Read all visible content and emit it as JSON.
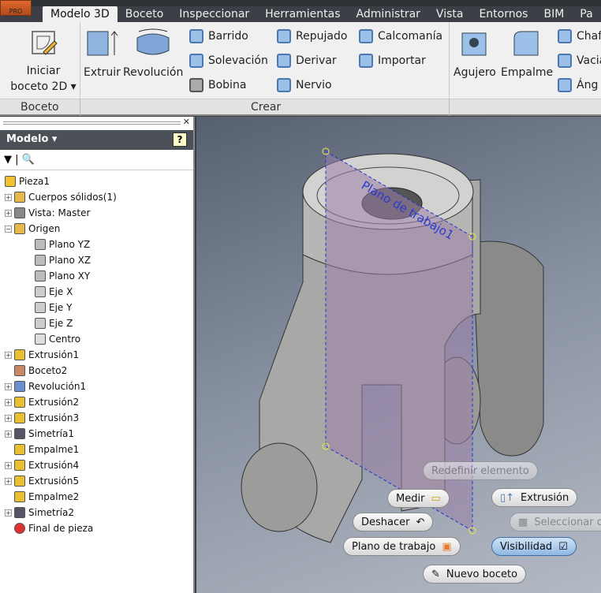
{
  "app": {
    "badge": "PRO"
  },
  "tabs": [
    "Modelo 3D",
    "Boceto",
    "Inspeccionar",
    "Herramientas",
    "Administrar",
    "Vista",
    "Entornos",
    "BIM",
    "Pa"
  ],
  "ribbon": {
    "boceto_panel": {
      "label": "Boceto",
      "start_sketch": "Iniciar",
      "start_sketch2": "boceto 2D"
    },
    "crear_panel": {
      "label": "Crear",
      "extrude": "Extruir",
      "revolve": "Revolución",
      "sweep": "Barrido",
      "loft": "Solevación",
      "coil": "Bobina",
      "emboss": "Repujado",
      "derive": "Derivar",
      "rib": "Nervio",
      "decal": "Calcomanía",
      "import": "Importar"
    },
    "modify": {
      "hole": "Agujero",
      "fillet": "Empalme",
      "chamfer": "Chaf",
      "shell": "Vacia",
      "draft": "Áng"
    }
  },
  "browser": {
    "title": "Modelo",
    "items": [
      {
        "label": "Pieza1",
        "level": 0,
        "icon": "part"
      },
      {
        "label": "Cuerpos sólidos(1)",
        "level": 1,
        "icon": "folder",
        "exp": true
      },
      {
        "label": "Vista: Master",
        "level": 1,
        "icon": "view",
        "exp": true
      },
      {
        "label": "Origen",
        "level": 1,
        "icon": "folder-open",
        "exp": true,
        "open": true
      },
      {
        "label": "Plano YZ",
        "level": 2,
        "icon": "plane"
      },
      {
        "label": "Plano XZ",
        "level": 2,
        "icon": "plane"
      },
      {
        "label": "Plano XY",
        "level": 2,
        "icon": "plane"
      },
      {
        "label": "Eje X",
        "level": 2,
        "icon": "axis"
      },
      {
        "label": "Eje Y",
        "level": 2,
        "icon": "axis"
      },
      {
        "label": "Eje Z",
        "level": 2,
        "icon": "axis"
      },
      {
        "label": "Centro",
        "level": 2,
        "icon": "point"
      },
      {
        "label": "Extrusión1",
        "level": 1,
        "icon": "extrude",
        "exp": true
      },
      {
        "label": "Boceto2",
        "level": 1,
        "icon": "sketch"
      },
      {
        "label": "Revolución1",
        "level": 1,
        "icon": "revolve",
        "exp": true
      },
      {
        "label": "Extrusión2",
        "level": 1,
        "icon": "extrude",
        "exp": true
      },
      {
        "label": "Extrusión3",
        "level": 1,
        "icon": "extrude",
        "exp": true
      },
      {
        "label": "Simetría1",
        "level": 1,
        "icon": "mirror",
        "exp": true
      },
      {
        "label": "Empalme1",
        "level": 1,
        "icon": "fillet"
      },
      {
        "label": "Extrusión4",
        "level": 1,
        "icon": "extrude",
        "exp": true
      },
      {
        "label": "Extrusión5",
        "level": 1,
        "icon": "extrude",
        "exp": true
      },
      {
        "label": "Empalme2",
        "level": 1,
        "icon": "fillet"
      },
      {
        "label": "Simetría2",
        "level": 1,
        "icon": "mirror",
        "exp": true
      },
      {
        "label": "Final de pieza",
        "level": 1,
        "icon": "end"
      }
    ]
  },
  "viewport": {
    "workplane_label": "Plano de trabajo1"
  },
  "marking_menu": {
    "redefine": "Redefinir elemento",
    "measure": "Medir",
    "extrusion": "Extrusión",
    "undo": "Deshacer",
    "select_other": "Seleccionar otro",
    "workplane": "Plano de trabajo",
    "visibility": "Visibilidad",
    "new_sketch": "Nuevo boceto"
  },
  "colors": {
    "accent": "#3b6ea5",
    "workplane": "#9a7fa8"
  }
}
